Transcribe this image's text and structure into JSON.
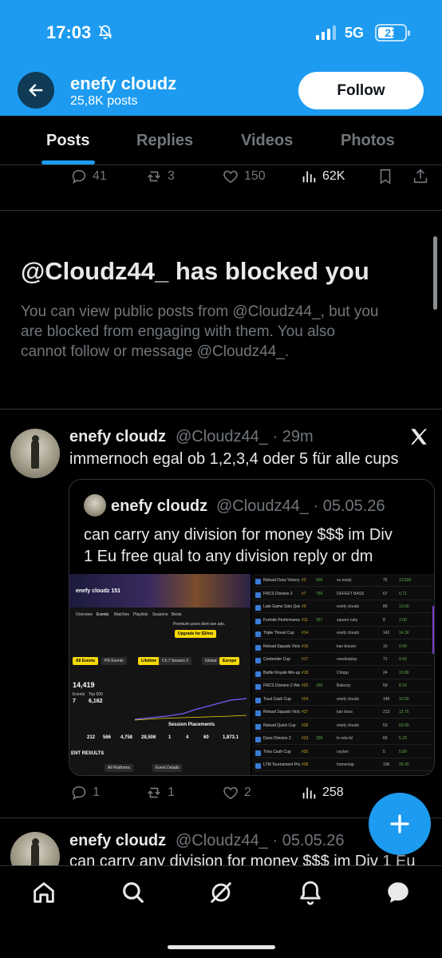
{
  "status_bar": {
    "time": "17:03",
    "network": "5G",
    "battery": "21"
  },
  "header": {
    "name": "enefy cloudz",
    "post_count": "25,8K posts",
    "follow_label": "Follow"
  },
  "tabs": [
    {
      "label": "Posts",
      "active": true
    },
    {
      "label": "Replies",
      "active": false
    },
    {
      "label": "Videos",
      "active": false
    },
    {
      "label": "Photos",
      "active": false
    }
  ],
  "top_actions": {
    "replies": "41",
    "reposts": "3",
    "likes": "150",
    "views": "62K"
  },
  "blocked": {
    "title": "@Cloudz44_ has blocked you",
    "line1": "You can view public posts from @Cloudz44_, but you",
    "line2": "are blocked from engaging with them. You also",
    "line3": "cannot follow or message @Cloudz44_."
  },
  "post1": {
    "name": "enefy cloudz",
    "handle": "@Cloudz44_ · 29m",
    "text": "immernoch egal ob 1,2,3,4 oder 5 für alle cups",
    "quote": {
      "name": "enefy cloudz",
      "handle": "@Cloudz44_ · 05.05.26",
      "line1": "can carry any division for money $$$ im Div",
      "line2": "1 Eu free qual to any division reply or dm",
      "screenshot": {
        "profile_name": "enefy cloudz 151",
        "nav": [
          "Overview",
          "Events",
          "Matches",
          "Playlists",
          "Seasons",
          "Bests"
        ],
        "premium_note": "Premium users dont see ads.",
        "upgrade": "Upgrade for $3/mo",
        "filters": [
          "All Events",
          "PR Events",
          "Lifetime",
          "Ch.7 Season 2",
          "Global",
          "Europe"
        ],
        "points": "14,419",
        "stat_labels": [
          "Events",
          "Top 500",
          "Wins"
        ],
        "stat_values": [
          "7",
          "6,162"
        ],
        "session_title": "Session Placements",
        "session_values": [
          "212",
          "566",
          "4,758",
          "28,506",
          "1",
          "4",
          "60",
          "1,873.1"
        ],
        "event_results": "ENT RESULTS",
        "platforms": "All Platforms",
        "search_placeholder": "Event Details",
        "events": [
          {
            "name": "Reload Duos Victory Cup",
            "rank": "#3",
            "pr": "400",
            "player": "vu nasty",
            "pts": "75",
            "kills": "13,500"
          },
          {
            "name": "FNCS Division 2",
            "rank": "#7",
            "pr": "750",
            "player": "DEFEET BASS",
            "pts": "67",
            "kills": "6.71"
          },
          {
            "name": "Late Game Solo Quick Cup",
            "rank": "#9",
            "pr": "",
            "player": "enefy cloudz",
            "pts": "85",
            "kills": "13.00"
          },
          {
            "name": "Fortnite Performance Evaluation",
            "rank": "#11",
            "pr": "357",
            "player": "squaro ruby",
            "pts": "8",
            "kills": "3.00"
          },
          {
            "name": "Triple Threat Cup",
            "rank": "#14",
            "pr": "",
            "player": "enefy cloudz",
            "pts": "142",
            "kills": "14.30"
          },
          {
            "name": "Reload Squads Victory Cup",
            "rank": "#16",
            "pr": "",
            "player": "kan bosser",
            "pts": "10",
            "kills": "9.00"
          },
          {
            "name": "Contender Cup",
            "rank": "#17",
            "pr": "",
            "player": "vnedenplay",
            "pts": "71",
            "kills": "9.42"
          },
          {
            "name": "Battle Royale Mix-up Monday",
            "rank": "#18",
            "pr": "",
            "player": "Chopp",
            "pts": "24",
            "kills": "10.80"
          },
          {
            "name": "FNCS Division 2 Week 2 Day 2",
            "rank": "#20",
            "pr": "165",
            "player": "Balezzy",
            "pts": "59",
            "kills": "8.16"
          },
          {
            "name": "Trust Cash Cup",
            "rank": "#24",
            "pr": "",
            "player": "enefy cloudz",
            "pts": "146",
            "kills": "10.00"
          },
          {
            "name": "Reload Squads Victory Cup",
            "rank": "#27",
            "pr": "",
            "player": "kan boss",
            "pts": "213",
            "kills": "12.75"
          },
          {
            "name": "Reload Quick Cup",
            "rank": "#28",
            "pr": "",
            "player": "enefy cloudz",
            "pts": "53",
            "kills": "63.00"
          },
          {
            "name": "Duos Division 2",
            "rank": "#33",
            "pr": "336",
            "player": "lo nda tol",
            "pts": "66",
            "kills": "5.29"
          },
          {
            "name": "Trios Cash Cup",
            "rank": "#35",
            "pr": "",
            "player": "ceylon",
            "pts": "5",
            "kills": "5.89"
          },
          {
            "name": "LTM Tournament Prize In Loco",
            "rank": "#38",
            "pr": "",
            "player": "homeclap",
            "pts": "106",
            "kills": "26.00"
          }
        ]
      }
    },
    "replies": "1",
    "reposts": "1",
    "likes": "2",
    "views": "258"
  },
  "post2": {
    "name": "enefy cloudz",
    "handle": "@Cloudz44_ · 05.05.26",
    "text": "can carry any division for money $$$ im Div 1 Eu"
  },
  "colors": {
    "accent": "#1d9bf0",
    "background": "#000000",
    "muted": "#71767b",
    "text": "#e7e9ea"
  },
  "icons": [
    "back-arrow-icon",
    "bell-off-icon",
    "x-logo-icon",
    "reply-icon",
    "repost-icon",
    "like-icon",
    "views-icon",
    "bookmark-icon",
    "share-icon",
    "home-icon",
    "search-icon",
    "grok-icon",
    "notifications-icon",
    "messages-icon",
    "compose-icon"
  ]
}
